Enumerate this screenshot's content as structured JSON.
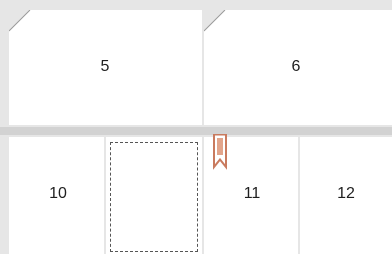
{
  "thumbnails": {
    "row1": [
      {
        "label": "5"
      },
      {
        "label": "6"
      }
    ],
    "row2": [
      {
        "label": "10"
      },
      {
        "label": ""
      },
      {
        "label": "11"
      },
      {
        "label": "12"
      }
    ]
  },
  "colors": {
    "background": "#e6e6e6",
    "page": "#ffffff",
    "separator": "#cfcfcf",
    "bookmark": "#d0856a",
    "insert_outline": "#555555"
  },
  "icons": {
    "fold": "page-fold-corner-icon",
    "bookmark": "bookmark-icon"
  }
}
